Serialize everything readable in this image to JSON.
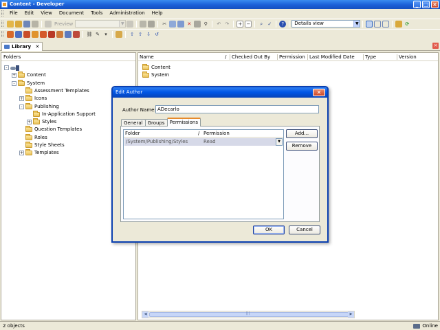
{
  "window": {
    "title": "Content - Developer"
  },
  "menu": [
    "File",
    "Edit",
    "View",
    "Document",
    "Tools",
    "Administration",
    "Help"
  ],
  "toolbar": {
    "preview_label": "Preview",
    "view_selector": "Details view"
  },
  "library_tab": {
    "label": "Library",
    "close": "✕"
  },
  "left_pane": {
    "header": "Folders",
    "tree": [
      {
        "label": "",
        "indent": 0,
        "expander": "-",
        "icon": "root",
        "row": 0
      },
      {
        "label": "Content",
        "indent": 1,
        "expander": "+",
        "icon": "folder",
        "row": 1
      },
      {
        "label": "System",
        "indent": 1,
        "expander": "-",
        "icon": "folder",
        "row": 2
      },
      {
        "label": "Assessment Templates",
        "indent": 2,
        "expander": "",
        "icon": "folder",
        "row": 3
      },
      {
        "label": "Icons",
        "indent": 2,
        "expander": "+",
        "icon": "folder",
        "row": 4
      },
      {
        "label": "Publishing",
        "indent": 2,
        "expander": "-",
        "icon": "folder",
        "row": 5
      },
      {
        "label": "In-Application Support",
        "indent": 3,
        "expander": "",
        "icon": "folder",
        "row": 6
      },
      {
        "label": "Styles",
        "indent": 3,
        "expander": "+",
        "icon": "folder",
        "row": 7
      },
      {
        "label": "Question Templates",
        "indent": 2,
        "expander": "",
        "icon": "folder",
        "row": 8
      },
      {
        "label": "Roles",
        "indent": 2,
        "expander": "",
        "icon": "folder",
        "row": 9
      },
      {
        "label": "Style Sheets",
        "indent": 2,
        "expander": "",
        "icon": "folder",
        "row": 10
      },
      {
        "label": "Templates",
        "indent": 2,
        "expander": "+",
        "icon": "folder",
        "row": 11
      }
    ]
  },
  "right_pane": {
    "columns": [
      "Name",
      "/",
      "Checked Out By",
      "Permission",
      "Last Modified Date",
      "Type",
      "Version"
    ],
    "items": [
      "Content",
      "System"
    ]
  },
  "status": {
    "left": "2 objects",
    "right": "Online"
  },
  "dialog": {
    "title": "Edit Author",
    "close": "✕",
    "author_label": "Author Name:",
    "author_value": "ADecarlo",
    "tabs": [
      "General",
      "Groups",
      "Permissions"
    ],
    "active_tab": "Permissions",
    "perm_columns": [
      "Folder",
      "/",
      "Permission"
    ],
    "perm_rows": [
      {
        "folder": "/System/Publishing/Styles",
        "permission": "Read"
      }
    ],
    "add_label": "Add...",
    "remove_label": "Remove",
    "ok_label": "OK",
    "cancel_label": "Cancel"
  }
}
